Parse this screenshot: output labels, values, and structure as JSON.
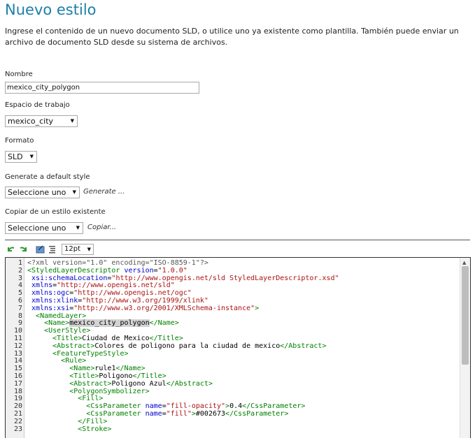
{
  "page": {
    "title": "Nuevo estilo",
    "intro": "Ingrese el contenido de un nuevo documento SLD, o utilice uno ya existente como plantilla. También puede enviar un archivo de documento SLD desde su sistema de archivos."
  },
  "form": {
    "name_label": "Nombre",
    "name_value": "mexico_city_polygon",
    "workspace_label": "Espacio de trabajo",
    "workspace_value": "mexico_city",
    "format_label": "Formato",
    "format_value": "SLD",
    "generate_label": "Generate a default style",
    "generate_select": "Seleccione uno",
    "generate_link": "Generate ...",
    "copy_label": "Copiar de un estilo existente",
    "copy_select": "Seleccione uno",
    "copy_link": "Copiar..."
  },
  "toolbar": {
    "icons": [
      "undo-icon",
      "redo-icon",
      "goto-line-icon",
      "reindent-icon"
    ],
    "font_size": "12pt"
  },
  "editor": {
    "line_numbers": [
      "1",
      "2",
      "3",
      "4",
      "5",
      "6",
      "7",
      "8",
      "9",
      "10",
      "11",
      "12",
      "13",
      "14",
      "15",
      "16",
      "17",
      "18",
      "19",
      "20",
      "21",
      "22",
      "23"
    ],
    "lines": [
      "<?xml version=\"1.0\" encoding=\"ISO-8859-1\"?>",
      "<StyledLayerDescriptor version=\"1.0.0\"",
      " xsi:schemaLocation=\"http://www.opengis.net/sld StyledLayerDescriptor.xsd\"",
      " xmlns=\"http://www.opengis.net/sld\"",
      " xmlns:ogc=\"http://www.opengis.net/ogc\"",
      " xmlns:xlink=\"http://www.w3.org/1999/xlink\"",
      " xmlns:xsi=\"http://www.w3.org/2001/XMLSchema-instance\">",
      "  <NamedLayer>",
      "    <Name>mexico_city_polygon</Name>",
      "    <UserStyle>",
      "      <Title>Ciudad de Mexico</Title>",
      "      <Abstract>Colores de poligono para la ciudad de mexico</Abstract>",
      "      <FeatureTypeStyle>",
      "        <Rule>",
      "          <Name>rule1</Name>",
      "          <Title>Poligono</Title>",
      "          <Abstract>Poligono Azul</Abstract>",
      "          <PolygonSymbolizer>",
      "            <Fill>",
      "              <CssParameter name=\"fill-opacity\">0.4</CssParameter>",
      "              <CssParameter name=\"fill\">#002673</CssParameter>",
      "            </Fill>",
      "            <Stroke>"
    ]
  },
  "colors": {
    "title": "#1d7fa8",
    "tag": "#008000",
    "attr": "#0000cc",
    "string": "#aa1111"
  }
}
